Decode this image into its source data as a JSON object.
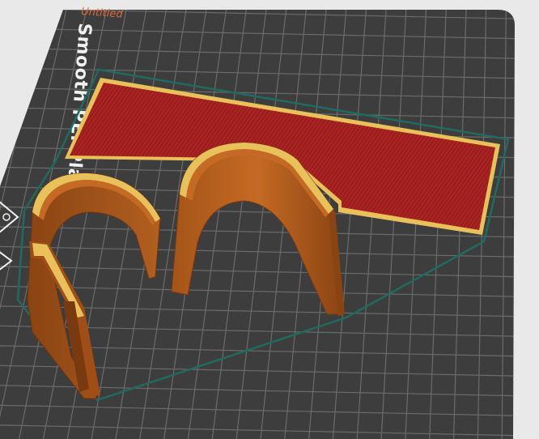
{
  "project": {
    "name": "Untitled"
  },
  "plate": {
    "label": "Smooth PEI Plate",
    "bed_color": "#3d3d3d",
    "grid_color": "#6b6b6b",
    "background_color": "#e9e9e9"
  },
  "preview": {
    "skirt_color": "#1f6b60",
    "top_surface_color": "#a01f1f",
    "wall_color": "#b8621c",
    "outline_color": "#e8c15a"
  },
  "icons": {
    "warning": "warning-triangle-icon",
    "arrow": "arrow-triangle-icon"
  }
}
